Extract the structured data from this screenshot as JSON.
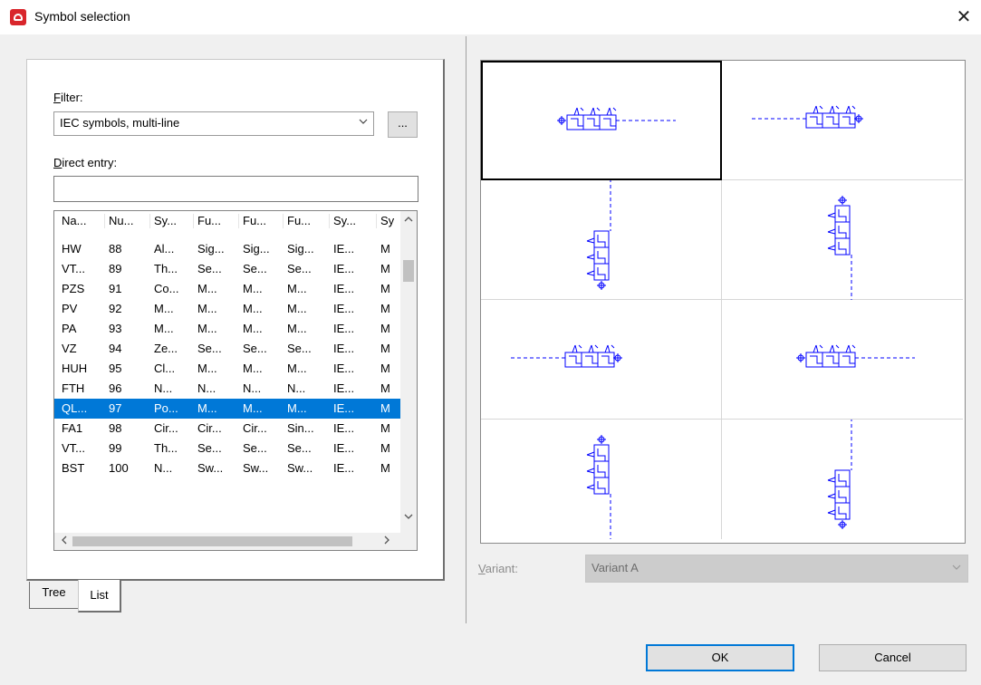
{
  "window": {
    "title": "Symbol selection",
    "close_glyph": "✕"
  },
  "filter": {
    "label_accel": "F",
    "label_rest": "ilter:",
    "value": "IEC symbols, multi-line",
    "more_label": "..."
  },
  "direct_entry": {
    "label_accel": "D",
    "label_rest": "irect entry:",
    "value": ""
  },
  "list": {
    "headers": [
      "Na...",
      "Nu...",
      "Sy...",
      "Fu...",
      "Fu...",
      "Fu...",
      "Sy...",
      "Sy"
    ],
    "rows": [
      [
        "HW",
        "88",
        "Al...",
        "Sig...",
        "Sig...",
        "Sig...",
        "IE...",
        "M"
      ],
      [
        "VT...",
        "89",
        "Th...",
        "Se...",
        "Se...",
        "Se...",
        "IE...",
        "M"
      ],
      [
        "PZS",
        "91",
        "Co...",
        "M...",
        "M...",
        "M...",
        "IE...",
        "M"
      ],
      [
        "PV",
        "92",
        "M...",
        "M...",
        "M...",
        "M...",
        "IE...",
        "M"
      ],
      [
        "PA",
        "93",
        "M...",
        "M...",
        "M...",
        "M...",
        "IE...",
        "M"
      ],
      [
        "VZ",
        "94",
        "Ze...",
        "Se...",
        "Se...",
        "Se...",
        "IE...",
        "M"
      ],
      [
        "HUH",
        "95",
        "Cl...",
        "M...",
        "M...",
        "M...",
        "IE...",
        "M"
      ],
      [
        "FTH",
        "96",
        "N...",
        "N...",
        "N...",
        "N...",
        "IE...",
        "M"
      ],
      [
        "QL...",
        "97",
        "Po...",
        "M...",
        "M...",
        "M...",
        "IE...",
        "M"
      ],
      [
        "FA1",
        "98",
        "Cir...",
        "Cir...",
        "Cir...",
        "Sin...",
        "IE...",
        "M"
      ],
      [
        "VT...",
        "99",
        "Th...",
        "Se...",
        "Se...",
        "Se...",
        "IE...",
        "M"
      ],
      [
        "BST",
        "100",
        "N...",
        "Sw...",
        "Sw...",
        "Sw...",
        "IE...",
        "M"
      ]
    ],
    "selected_index": 8
  },
  "tabs": {
    "tree": "Tree",
    "list": "List",
    "active": "list"
  },
  "variant": {
    "label_accel": "V",
    "label_rest": "ariant:",
    "value": "Variant A"
  },
  "buttons": {
    "ok": "OK",
    "cancel": "Cancel"
  },
  "colors": {
    "symbol": "#0000ff",
    "selection": "#0078d7"
  },
  "icons": {
    "scroll_up": "^",
    "scroll_down": "v",
    "scroll_left": "<",
    "scroll_right": ">",
    "dropdown": "v"
  }
}
